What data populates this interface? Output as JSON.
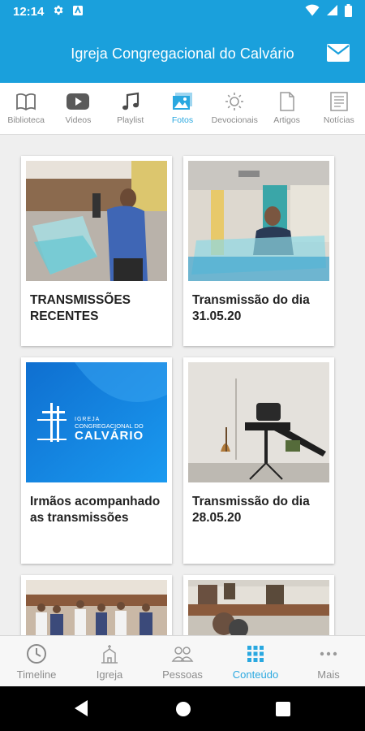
{
  "status_bar": {
    "time": "12:14"
  },
  "app_bar": {
    "title": "Igreja Congregacional do Calvário"
  },
  "tabs": [
    {
      "label": "Biblioteca",
      "icon": "book-icon",
      "active": false
    },
    {
      "label": "Videos",
      "icon": "video-icon",
      "active": false
    },
    {
      "label": "Playlist",
      "icon": "music-icon",
      "active": false
    },
    {
      "label": "Fotos",
      "icon": "photos-icon",
      "active": true
    },
    {
      "label": "Devocionais",
      "icon": "sun-icon",
      "active": false
    },
    {
      "label": "Artigos",
      "icon": "document-icon",
      "active": false
    },
    {
      "label": "Notícias",
      "icon": "news-icon",
      "active": false
    }
  ],
  "albums": [
    {
      "title": "TRANSMISSÕES RECENTES"
    },
    {
      "title": "Transmissão do dia 31.05.20"
    },
    {
      "title": "Irmãos acompanhado as transmissões",
      "logo_text": {
        "line1": "IGREJA",
        "line2": "CONGREGACIONAL DO",
        "line3": "CALVÁRIO"
      }
    },
    {
      "title": "Transmissão do dia 28.05.20"
    },
    {
      "title": ""
    },
    {
      "title": ""
    }
  ],
  "bottom_nav": [
    {
      "label": "Timeline",
      "icon": "clock-icon",
      "active": false
    },
    {
      "label": "Igreja",
      "icon": "church-icon",
      "active": false
    },
    {
      "label": "Pessoas",
      "icon": "people-icon",
      "active": false
    },
    {
      "label": "Conteúdo",
      "icon": "grid-icon",
      "active": true
    },
    {
      "label": "Mais",
      "icon": "more-icon",
      "active": false
    }
  ],
  "colors": {
    "primary": "#1aa0dc",
    "accent": "#2aa8e0",
    "inactive": "#8a8a8a"
  }
}
